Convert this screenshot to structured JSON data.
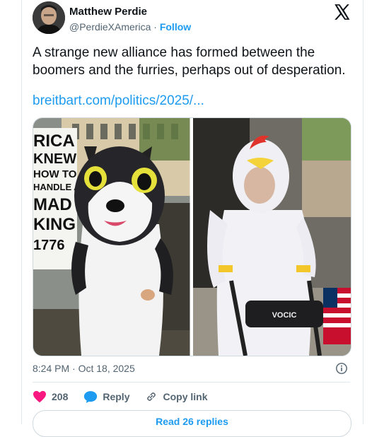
{
  "author": {
    "name": "Matthew Perdie",
    "handle": "@PerdieXAmerica",
    "separator": "·",
    "follow_label": "Follow"
  },
  "post": {
    "text": "A strange new alliance has formed between the boomers and the furries, perhaps out of desperation.",
    "link": "breitbart.com/politics/2025/...",
    "timestamp": "8:24 PM · Oct 18, 2025"
  },
  "media": {
    "left_sign_lines": [
      "RICA",
      "KNEW",
      "HOW TO",
      "HANDLE A",
      "MAD",
      "KING",
      "1776"
    ],
    "walker_brand": "VOCIC"
  },
  "actions": {
    "like_count": "208",
    "reply_label": "Reply",
    "copy_label": "Copy link"
  },
  "read_replies_label": "Read 26 replies",
  "colors": {
    "accent": "#1d9bf0",
    "like": "#f91880",
    "muted": "#536471"
  }
}
